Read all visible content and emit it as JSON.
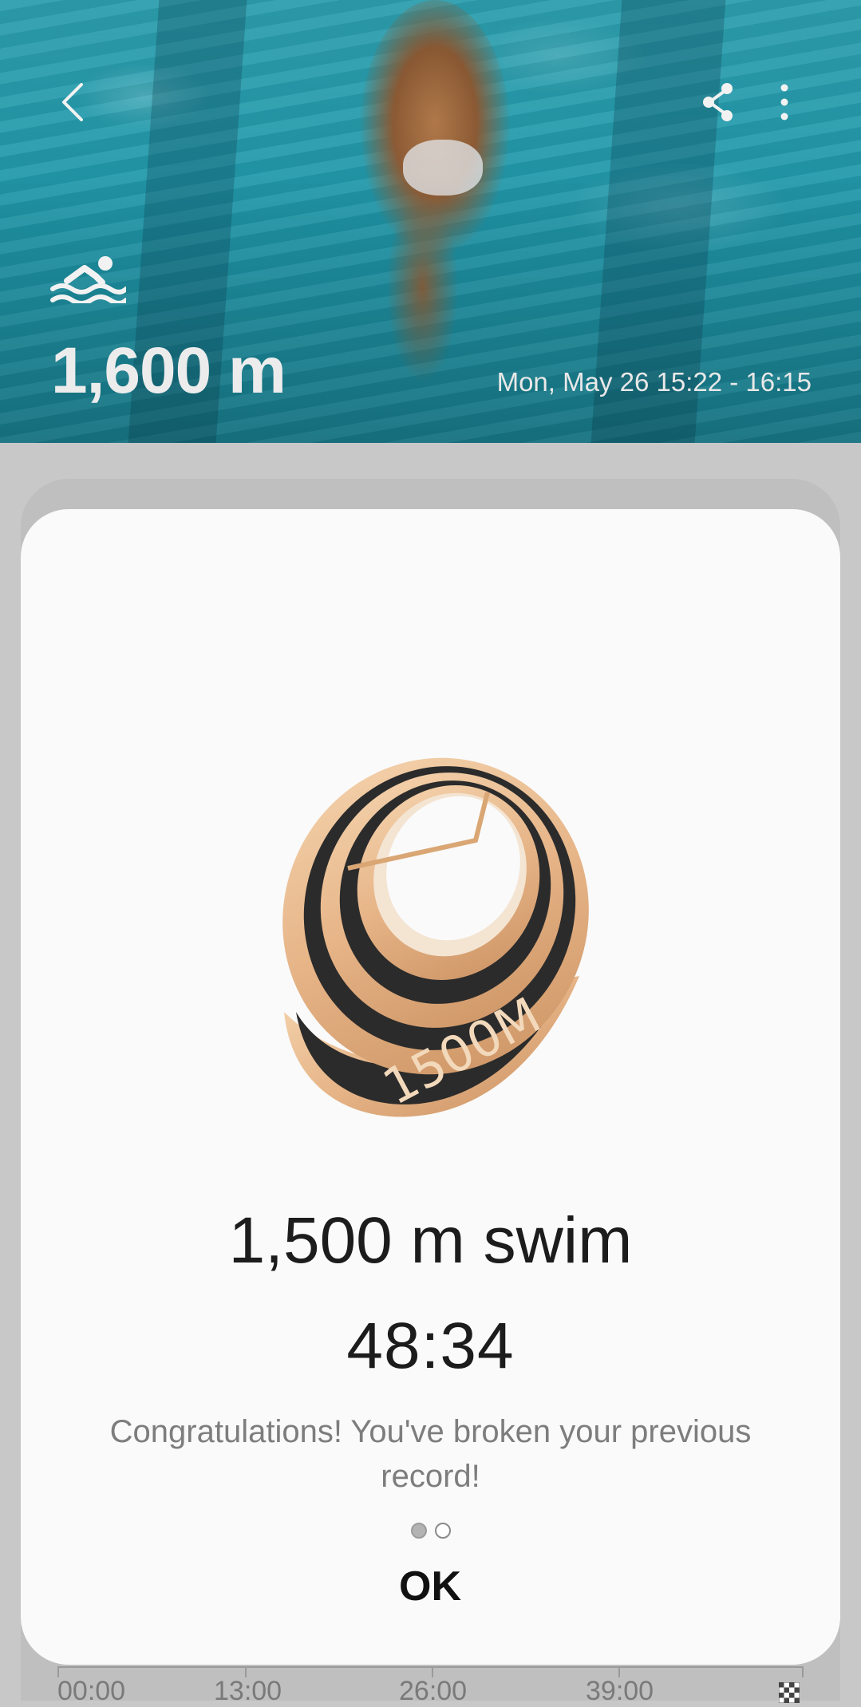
{
  "header": {
    "distance": "1,600 m",
    "datetime": "Mon, May 26 15:22 - 16:15",
    "icons": {
      "back": "back-arrow-icon",
      "share": "share-icon",
      "more": "more-vert-icon",
      "activity": "swimming-icon"
    }
  },
  "record_dialog": {
    "badge_label": "1500M",
    "title": "1,500 m swim",
    "time": "48:34",
    "message": "Congratulations! You've broken your previous record!",
    "page_count": 2,
    "current_page": 1,
    "ok_label": "OK"
  },
  "timeline_axis": {
    "labels": [
      "00:00",
      "13:00",
      "26:00",
      "39:00"
    ],
    "end_icon": "finish-flag-icon"
  },
  "colors": {
    "pool_water": "#1f96a8",
    "dialog_bg": "#fafafa",
    "scrim": "#c8c8c8",
    "badge_gold": "#e8b98a",
    "badge_dark": "#2b2b2b"
  }
}
